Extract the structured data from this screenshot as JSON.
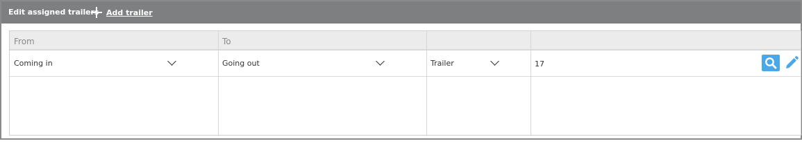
{
  "header": {
    "title": "Edit assigned trailers",
    "add_label": "Add trailer",
    "add_icon": "plus-icon"
  },
  "table": {
    "columns": [
      "From",
      "To",
      "",
      ""
    ],
    "row": {
      "from": "Coming in",
      "to": "Going out",
      "type": "Trailer",
      "value": "17"
    },
    "actions": {
      "search_icon": "magnifier-icon",
      "edit_icon": "pencil-icon"
    }
  },
  "colors": {
    "header_bg": "#7d7f80",
    "accent": "#4aa8e8"
  }
}
